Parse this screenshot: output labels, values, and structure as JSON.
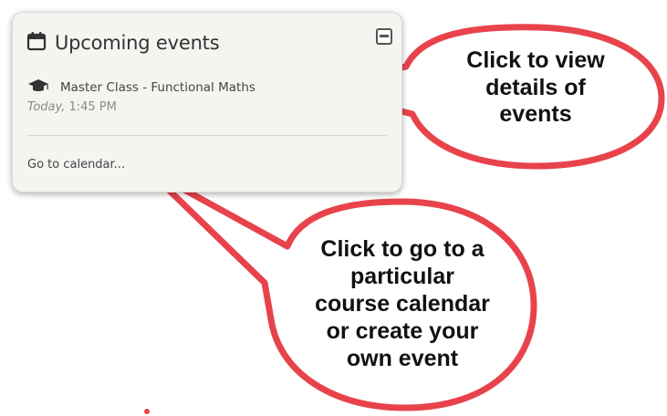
{
  "card": {
    "title": "Upcoming events",
    "event": {
      "name": "Master Class - Functional Maths",
      "time_day": "Today,",
      "time_clock": " 1:45 PM"
    },
    "calendar_link": "Go to calendar..."
  },
  "callouts": {
    "details": [
      "Click to view",
      "details of",
      "events"
    ],
    "calendar": [
      "Click to go to a",
      "particular",
      "course calendar",
      "or create your",
      "own event"
    ]
  },
  "icons": {
    "title_icon": "calendar-icon",
    "event_icon": "graduation-cap-icon",
    "collapse_icon": "collapse-icon"
  },
  "colors": {
    "callout_border": "#e8434b",
    "card_background": "#f5f4f1"
  }
}
